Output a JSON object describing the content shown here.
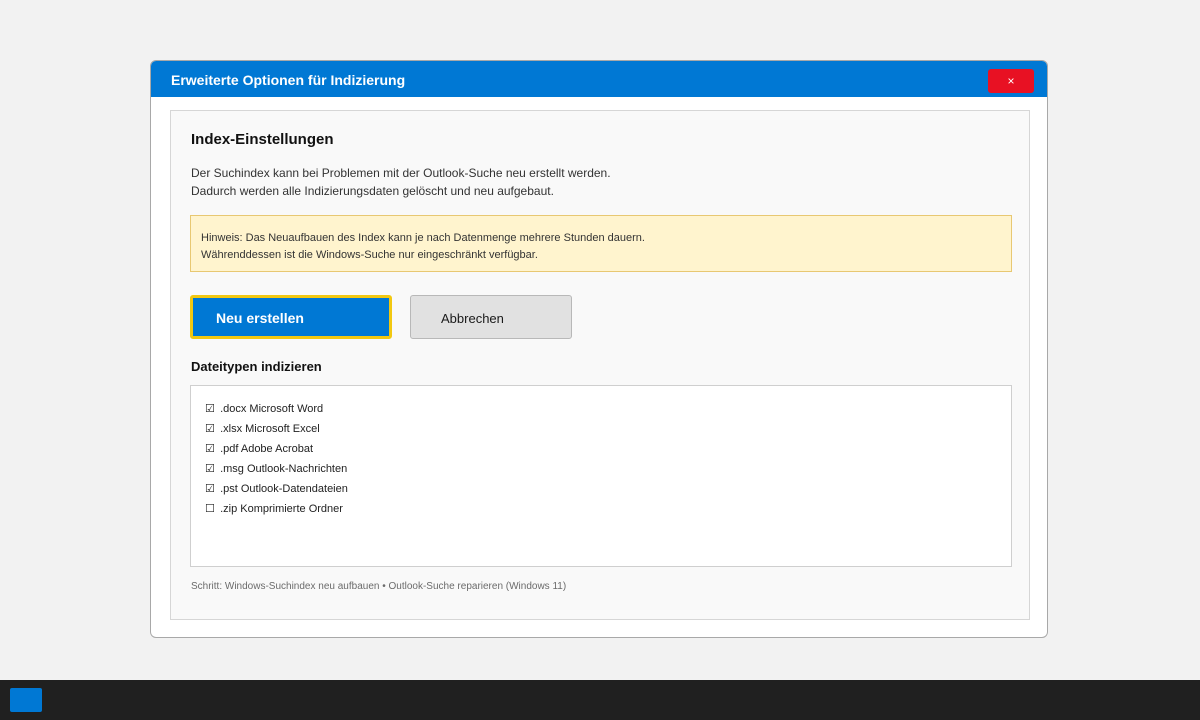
{
  "dialog": {
    "title": "Erweiterte Optionen für Indizierung",
    "close_label": "×"
  },
  "index": {
    "heading": "Index-Einstellungen",
    "description_lines": [
      "Der Suchindex kann bei Problemen mit der Outlook-Suche neu erstellt werden.",
      "Dadurch werden alle Indizierungsdaten gelöscht und neu aufgebaut."
    ],
    "notice_lines": [
      "Hinweis: Das Neuaufbauen des Index kann je nach Datenmenge mehrere Stunden dauern.",
      "Währenddessen ist die Windows-Suche nur eingeschränkt verfügbar."
    ],
    "rebuild_label": "Neu erstellen",
    "cancel_label": "Abbrechen"
  },
  "filetypes": {
    "heading": "Dateitypen indizieren",
    "items": [
      {
        "checked": true,
        "mark": "☑",
        "label": ".docx Microsoft Word"
      },
      {
        "checked": true,
        "mark": "☑",
        "label": ".xlsx Microsoft Excel"
      },
      {
        "checked": true,
        "mark": "☑",
        "label": ".pdf Adobe Acrobat"
      },
      {
        "checked": true,
        "mark": "☑",
        "label": ".msg Outlook-Nachrichten"
      },
      {
        "checked": true,
        "mark": "☑",
        "label": ".pst Outlook-Datendateien"
      },
      {
        "checked": false,
        "mark": "☐",
        "label": ".zip Komprimierte Ordner"
      }
    ]
  },
  "footer": {
    "step_text": "Schritt: Windows-Suchindex neu aufbauen • Outlook-Suche reparieren (Windows 11)"
  },
  "colors": {
    "accent": "#0078d4",
    "close": "#e81123",
    "focus_ring": "#f2c811",
    "notice_bg": "#fff4ce"
  }
}
